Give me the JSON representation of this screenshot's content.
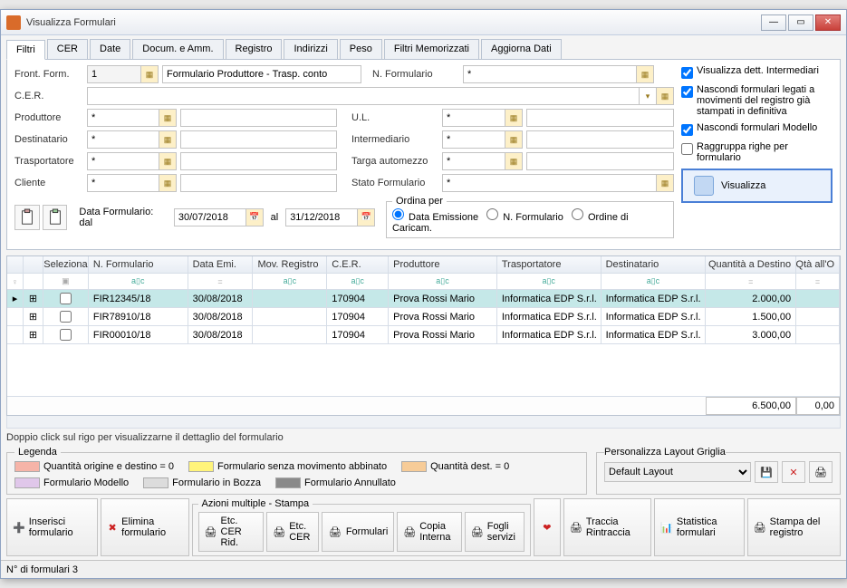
{
  "window": {
    "title": "Visualizza Formulari"
  },
  "tabs": [
    "Filtri",
    "CER",
    "Date",
    "Docum. e Amm.",
    "Registro",
    "Indirizzi",
    "Peso",
    "Filtri Memorizzati",
    "Aggiorna Dati"
  ],
  "filters": {
    "frontForm": {
      "label": "Front. Form.",
      "num": "1",
      "desc": "Formulario Produttore - Trasp. conto"
    },
    "nFormulario": {
      "label": "N. Formulario",
      "value": "*"
    },
    "cer": {
      "label": "C.E.R."
    },
    "produttore": {
      "label": "Produttore",
      "value": "*"
    },
    "destinatario": {
      "label": "Destinatario",
      "value": "*"
    },
    "trasportatore": {
      "label": "Trasportatore",
      "value": "*"
    },
    "cliente": {
      "label": "Cliente",
      "value": "*"
    },
    "ul": {
      "label": "U.L.",
      "value": "*"
    },
    "intermediario": {
      "label": "Intermediario",
      "value": "*"
    },
    "targa": {
      "label": "Targa automezzo",
      "value": "*"
    },
    "stato": {
      "label": "Stato Formulario",
      "value": "*"
    },
    "dataForm": {
      "label": "Data Formulario: dal",
      "from": "30/07/2018",
      "to_label": "al",
      "to": "31/12/2018"
    },
    "ordina": {
      "legend": "Ordina per",
      "opt1": "Data Emissione",
      "opt2": "N. Formulario",
      "opt3": "Ordine di Caricam."
    }
  },
  "sideChecks": {
    "vdi": "Visualizza dett. Intermediari",
    "nascondiReg": "Nascondi formulari legati a movimenti del registro già stampati in definitiva",
    "nascondiMod": "Nascondi formulari Modello",
    "raggruppa": "Raggruppa righe per formulario",
    "visualizzaBtn": "Visualizza"
  },
  "grid": {
    "headers": {
      "sel": "Seleziona",
      "num": "N. Formulario",
      "date": "Data Emi.",
      "mov": "Mov. Registro",
      "cer": "C.E.R.",
      "prod": "Produttore",
      "trasp": "Trasportatore",
      "dest": "Destinatario",
      "qty": "Quantità a Destino",
      "qtyo": "Qtà all'O"
    },
    "rows": [
      {
        "num": "FIR12345/18",
        "date": "30/08/2018",
        "mov": "",
        "cer": "170904",
        "prod": "Prova Rossi Mario",
        "trasp": "Informatica EDP S.r.l.",
        "dest": "Informatica EDP S.r.l.",
        "qty": "2.000,00",
        "selected": true
      },
      {
        "num": "FIR78910/18",
        "date": "30/08/2018",
        "mov": "",
        "cer": "170904",
        "prod": "Prova Rossi Mario",
        "trasp": "Informatica EDP S.r.l.",
        "dest": "Informatica EDP S.r.l.",
        "qty": "1.500,00"
      },
      {
        "num": "FIR00010/18",
        "date": "30/08/2018",
        "mov": "",
        "cer": "170904",
        "prod": "Prova Rossi Mario",
        "trasp": "Informatica EDP S.r.l.",
        "dest": "Informatica EDP S.r.l.",
        "qty": "3.000,00"
      }
    ],
    "footer": {
      "total": "6.500,00",
      "total2": "0,00"
    }
  },
  "hint": "Doppio click sul rigo per visualizzarne il dettaglio del formulario",
  "legenda": {
    "title": "Legenda",
    "items": [
      {
        "color": "#f6b4a8",
        "text": "Quantità origine e destino = 0"
      },
      {
        "color": "#fff47a",
        "text": "Formulario senza movimento abbinato"
      },
      {
        "color": "#f7cc98",
        "text": "Quantità dest. = 0"
      },
      {
        "color": "#e0c7ea",
        "text": "Formulario Modello"
      },
      {
        "color": "#dcdcdc",
        "text": "Formulario in Bozza"
      },
      {
        "color": "#8a8a8a",
        "text": "Formulario Annullato"
      }
    ]
  },
  "persLayout": {
    "title": "Personalizza Layout Griglia",
    "value": "Default Layout"
  },
  "azioniTitle": "Azioni multiple - Stampa",
  "actions": {
    "inserisci": "Inserisci formulario",
    "elimina": "Elimina formulario",
    "etcCerRid": "Etc. CER Rid.",
    "etcCer": "Etc. CER",
    "formulari": "Formulari",
    "copiaInterna": "Copia Interna",
    "fogliServizi": "Fogli servizi",
    "traccia": "Traccia Rintraccia",
    "statistica": "Statistica formulari",
    "stampaReg": "Stampa del registro"
  },
  "status": "N° di formulari 3"
}
